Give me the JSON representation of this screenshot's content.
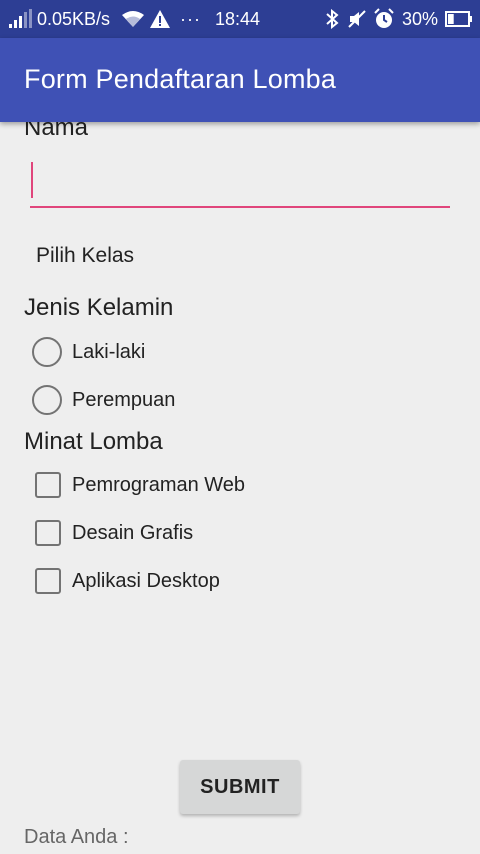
{
  "status_bar": {
    "network_speed": "0.05KB/s",
    "more": "···",
    "time": "18:44",
    "battery_percent": "30%",
    "battery_level": 0.3,
    "icons": [
      "signal-icon",
      "wifi-icon",
      "warning-icon",
      "bluetooth-icon",
      "mute-icon",
      "alarm-icon",
      "battery-icon"
    ]
  },
  "app_bar": {
    "title": "Form Pendaftaran Lomba"
  },
  "form": {
    "name_label": "Nama",
    "name_value": "",
    "class_spinner_label": "Pilih Kelas",
    "gender_label": "Jenis Kelamin",
    "gender_options": [
      "Laki-laki",
      "Perempuan"
    ],
    "interest_label": "Minat Lomba",
    "interest_options": [
      "Pemrograman Web",
      "Desain Grafis",
      "Aplikasi Desktop"
    ],
    "submit_label": "SUBMIT",
    "result_label": "Data Anda :"
  },
  "colors": {
    "status_bar": "#2d3e94",
    "app_bar": "#3f51b5",
    "accent": "#e0457b",
    "background": "#eeeeee"
  }
}
